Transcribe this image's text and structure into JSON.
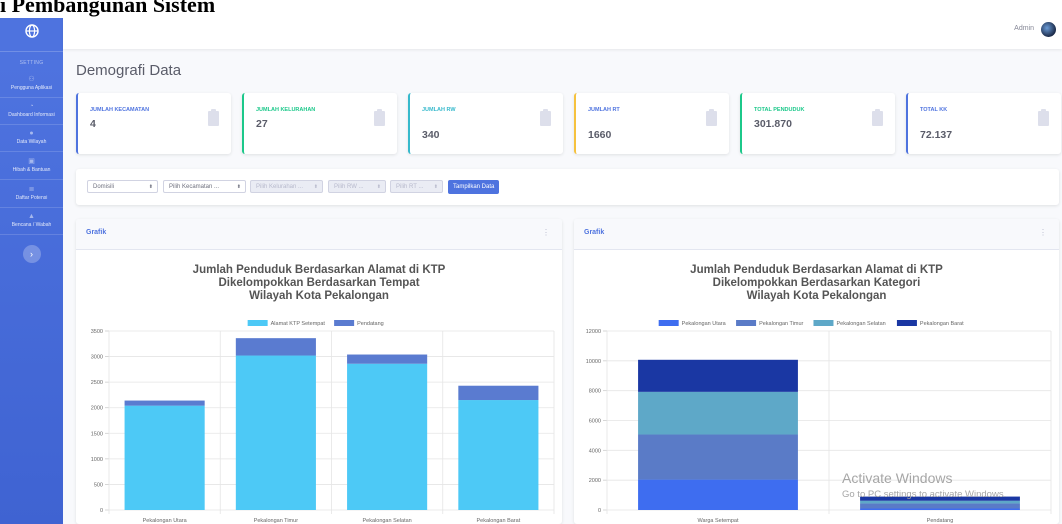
{
  "caption": "i Pembangunan Sistem",
  "sidebar": {
    "heading": "SETTING",
    "items": [
      {
        "label": "Pengguna Aplikasi",
        "icon": "users-icon"
      },
      {
        "label": "Dashboard Informasi",
        "icon": "dashboard-icon"
      },
      {
        "label": "Data Wilayah",
        "icon": "map-icon"
      },
      {
        "label": "Hibah & Bantuan",
        "icon": "gift-icon"
      },
      {
        "label": "Daftar Potensi",
        "icon": "list-icon"
      },
      {
        "label": "Bencana / Wabah",
        "icon": "warning-icon"
      }
    ],
    "toggle": "›"
  },
  "topbar": {
    "user": "Admin"
  },
  "page_title": "Demografi Data",
  "cards": [
    {
      "label": "JUMLAH KECAMATAN",
      "value": "4",
      "color": "#4e73df"
    },
    {
      "label": "JUMLAH KELURAHAN",
      "value": "27",
      "color": "#1cc88a"
    },
    {
      "label": "JUMLAH RW",
      "value": "340",
      "color": "#36b9cc"
    },
    {
      "label": "JUMLAH RT",
      "value": "1660",
      "color": "#f6c23e"
    },
    {
      "label": "TOTAL PENDUDUK",
      "value": "301.870",
      "color": "#1cc88a"
    },
    {
      "label": "TOTAL KK",
      "value": "72.137",
      "color": "#4e73df"
    }
  ],
  "filters": {
    "domisili": "Domisili",
    "kecamatan": "Pilih Kecamatan ...",
    "kelurahan": "Pilih Kelurahan ...",
    "rw": "Pilih RW ...",
    "rt": "Pilih RT ...",
    "button": "Tampilkan Data"
  },
  "panels": [
    {
      "title": "Grafik"
    },
    {
      "title": "Grafik"
    }
  ],
  "chart_data": [
    {
      "type": "bar",
      "title": [
        "Jumlah Penduduk Berdasarkan Alamat di KTP",
        "Dikelompokkan Berdasarkan Tempat",
        "Wilayah Kota Pekalongan"
      ],
      "stacked": true,
      "categories": [
        "Pekalongan Utara",
        "Pekalongan Timur",
        "Pekalongan Selatan",
        "Pekalongan Barat"
      ],
      "series": [
        {
          "name": "Alamat KTP Setempat",
          "color": "#4dc9f6",
          "values": [
            2040,
            3020,
            2860,
            2150
          ]
        },
        {
          "name": "Pendatang",
          "color": "#5a7bd0",
          "values": [
            100,
            340,
            180,
            280
          ]
        }
      ],
      "ylim": [
        0,
        3500
      ],
      "yticks": [
        0,
        500,
        1000,
        1500,
        2000,
        2500,
        3000,
        3500
      ],
      "grid": true,
      "legend": "top"
    },
    {
      "type": "bar",
      "title": [
        "Jumlah Penduduk Berdasarkan Alamat di KTP",
        "Dikelompokkan Berdasarkan Kategori",
        "Wilayah Kota Pekalongan"
      ],
      "stacked": true,
      "categories": [
        "Warga Setempat",
        "Pendatang"
      ],
      "series": [
        {
          "name": "Pekalongan Utara",
          "color": "#3e6df0",
          "values": [
            2040,
            100
          ]
        },
        {
          "name": "Pekalongan Timur",
          "color": "#5a7bc7",
          "values": [
            3020,
            340
          ]
        },
        {
          "name": "Pekalongan Selatan",
          "color": "#5ea8c8",
          "values": [
            2860,
            180
          ]
        },
        {
          "name": "Pekalongan Barat",
          "color": "#1a37a3",
          "values": [
            2150,
            280
          ]
        }
      ],
      "ylim": [
        0,
        12000
      ],
      "yticks": [
        0,
        2000,
        4000,
        6000,
        8000,
        10000,
        12000
      ],
      "grid": true,
      "legend": "top"
    }
  ],
  "watermark": {
    "title": "Activate Windows",
    "sub": "Go to PC settings to activate Windows."
  }
}
